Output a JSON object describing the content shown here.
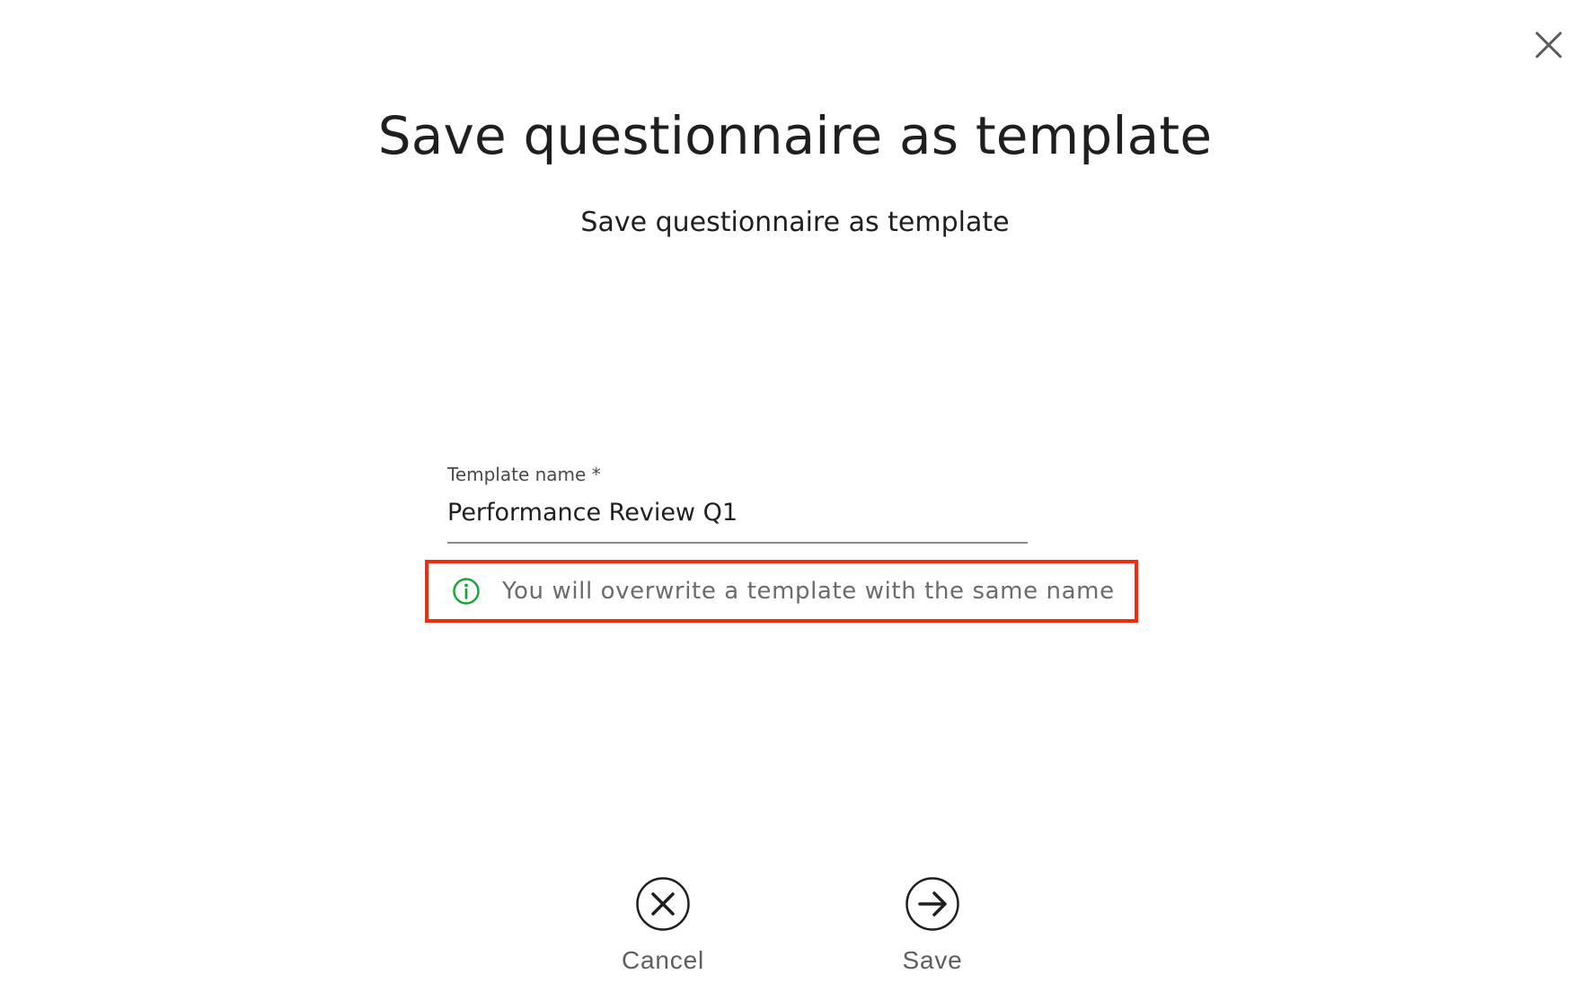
{
  "dialog": {
    "title": "Save questionnaire as template",
    "subtitle": "Save questionnaire as template"
  },
  "form": {
    "template_name_label": "Template name *",
    "template_name_value": "Performance Review Q1"
  },
  "warning": {
    "icon": "info-icon",
    "text": "You will overwrite a template with the same name"
  },
  "actions": {
    "cancel_label": "Cancel",
    "cancel_icon": "close-circle-icon",
    "save_label": "Save",
    "save_icon": "arrow-right-circle-icon"
  },
  "icons": {
    "close": "close-icon"
  },
  "colors": {
    "highlight_border": "#f02c0c",
    "info_icon": "#1aa53b",
    "text_primary": "#1f1f1f",
    "text_muted": "#6b6b6b"
  }
}
